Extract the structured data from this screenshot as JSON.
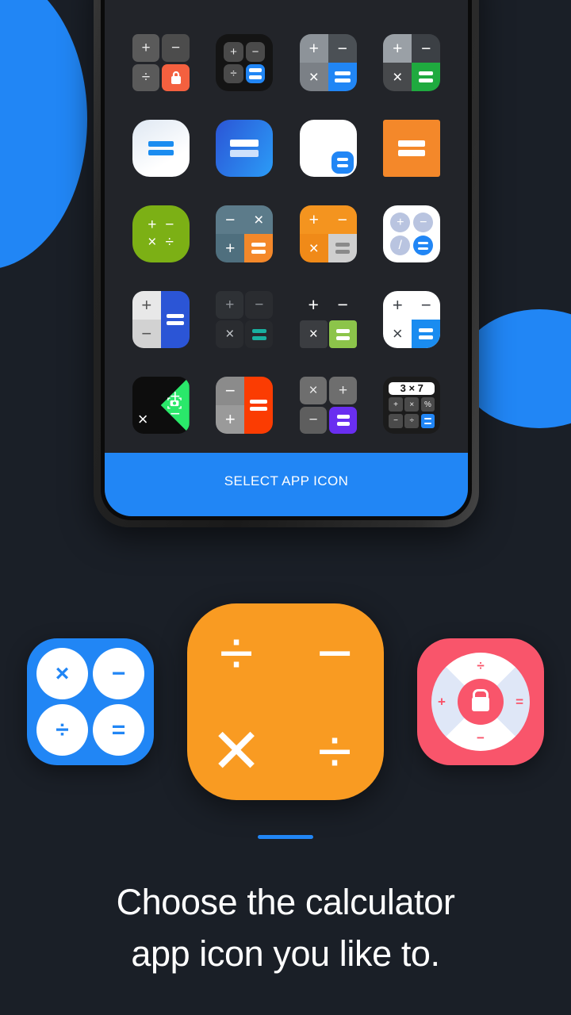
{
  "background": {
    "color": "#1a1f27",
    "accent": "#2186f5",
    "blobs": [
      "blue-circle-left",
      "blue-circle-right"
    ]
  },
  "phone": {
    "frame_color": "#2b2b2b",
    "screen_color": "#222429",
    "select_button": {
      "label": "SELECT APP ICON",
      "background": "#2186f5",
      "text_color": "#ffffff"
    },
    "icon_grid": {
      "columns": 4,
      "rows": 5,
      "icons": [
        {
          "id": "icon-1",
          "name": "gray-quad-lock",
          "symbols": [
            "+",
            "−",
            "÷",
            "lock"
          ],
          "colors": [
            "#5a5a5a",
            "#4c4c4c",
            "#5a5a5a",
            "#f4603f"
          ]
        },
        {
          "id": "icon-2",
          "name": "dark-quad-blue-equals",
          "symbols": [
            "+",
            "−",
            "÷",
            "="
          ],
          "colors": [
            "#4a4a4a",
            "#4a4a4a",
            "#4a4a4a",
            "#2186f5"
          ]
        },
        {
          "id": "icon-3",
          "name": "gray-quad-blue-equals",
          "symbols": [
            "+",
            "−",
            "×",
            "="
          ],
          "colors": [
            "#8d9399",
            "#4b5055",
            "#7b8086",
            "#2186f5"
          ]
        },
        {
          "id": "icon-4",
          "name": "gray-quad-green-equals",
          "symbols": [
            "+",
            "−",
            "×",
            "="
          ],
          "colors": [
            "#9aa0a6",
            "#3c4045",
            "#47494c",
            "#1faa3f"
          ]
        },
        {
          "id": "icon-5",
          "name": "white-gradient-equals",
          "symbols": [
            "="
          ],
          "colors": [
            "#f2f6fb",
            "#2186f5"
          ]
        },
        {
          "id": "icon-6",
          "name": "blue-gradient-equals",
          "symbols": [
            "="
          ],
          "colors": [
            "#2e6df0",
            "#2b9cf7",
            "#ffffff"
          ]
        },
        {
          "id": "icon-7",
          "name": "white-blue-equals-badge",
          "symbols": [
            "+",
            "−",
            "×",
            "="
          ],
          "colors": [
            "#ffffff",
            "#3d4248",
            "#2186f5"
          ]
        },
        {
          "id": "icon-8",
          "name": "orange-equals",
          "symbols": [
            "="
          ],
          "colors": [
            "#f4882a",
            "#ffffff"
          ]
        },
        {
          "id": "icon-9",
          "name": "olive-four-ops",
          "symbols": [
            "+",
            "−",
            "×",
            "÷"
          ],
          "colors": [
            "#7cb015",
            "#ffffff"
          ]
        },
        {
          "id": "icon-10",
          "name": "slate-orange-equals",
          "symbols": [
            "−",
            "×",
            "+",
            "="
          ],
          "colors": [
            "#5c7b8a",
            "#4f6f7e",
            "#f4882a"
          ]
        },
        {
          "id": "icon-11",
          "name": "orange-gray-equals",
          "symbols": [
            "+",
            "−",
            "×",
            "="
          ],
          "colors": [
            "#f4941f",
            "#f08a18",
            "#cfcfcf"
          ]
        },
        {
          "id": "icon-12",
          "name": "white-circles-equals",
          "symbols": [
            "+",
            "−",
            "/",
            "="
          ],
          "colors": [
            "#ffffff",
            "#b9c4e0",
            "#2186f5"
          ]
        },
        {
          "id": "icon-13",
          "name": "white-blue-split",
          "symbols": [
            "+",
            "−",
            "="
          ],
          "colors": [
            "#e8e8e8",
            "#d2d2d2",
            "#2b55d6"
          ]
        },
        {
          "id": "icon-14",
          "name": "dark-teal-equals",
          "symbols": [
            "+",
            "−",
            "×",
            "="
          ],
          "colors": [
            "#2e3135",
            "#27292d",
            "#19b0a0"
          ]
        },
        {
          "id": "icon-15",
          "name": "dark-green-equals",
          "symbols": [
            "+",
            "−",
            "×",
            "="
          ],
          "colors": [
            "#222429",
            "#3b3d41",
            "#8cc44a"
          ]
        },
        {
          "id": "icon-16",
          "name": "white-blue-equals",
          "symbols": [
            "+",
            "−",
            "×",
            "="
          ],
          "colors": [
            "#ffffff",
            "#3d4248",
            "#1a8cf0"
          ]
        },
        {
          "id": "icon-17",
          "name": "black-green-camera",
          "symbols": [
            "+",
            "×",
            "−",
            "camera"
          ],
          "colors": [
            "#0d0d0d",
            "#2ae86a"
          ]
        },
        {
          "id": "icon-18",
          "name": "gray-red-equals",
          "symbols": [
            "−",
            "+",
            "="
          ],
          "colors": [
            "#8b8b8b",
            "#9a9a9a",
            "#fb3c02"
          ]
        },
        {
          "id": "icon-19",
          "name": "gray-purple-equals",
          "symbols": [
            "×",
            "+",
            "−",
            "="
          ],
          "colors": [
            "#6e6e6e",
            "#5e5e5e",
            "#6a2ef0"
          ]
        },
        {
          "id": "icon-20",
          "name": "mini-calculator-3x7",
          "display": "3 × 7",
          "keys": [
            "+",
            "×",
            "%",
            "−",
            "÷",
            "="
          ],
          "colors": [
            "#1b1b1b",
            "#ffffff",
            "#4a4a4a",
            "#2186f5"
          ]
        }
      ]
    }
  },
  "featured_icons": [
    {
      "id": "featured-blue",
      "name": "blue-four-circles-icon",
      "color": "#2186f5",
      "symbols": [
        "×",
        "−",
        "÷",
        "="
      ]
    },
    {
      "id": "featured-orange",
      "name": "orange-operators-icon",
      "color": "#f99b22",
      "symbols": [
        "÷",
        "−",
        "✕",
        "÷"
      ]
    },
    {
      "id": "featured-red",
      "name": "red-lock-dial-icon",
      "color": "#f9556b",
      "symbols": [
        "÷",
        "+",
        "=",
        "−"
      ],
      "center": "lock"
    }
  ],
  "caption": {
    "line1": "Choose the calculator",
    "line2": "app icon you like to."
  },
  "divider": {
    "color": "#2186f5"
  }
}
